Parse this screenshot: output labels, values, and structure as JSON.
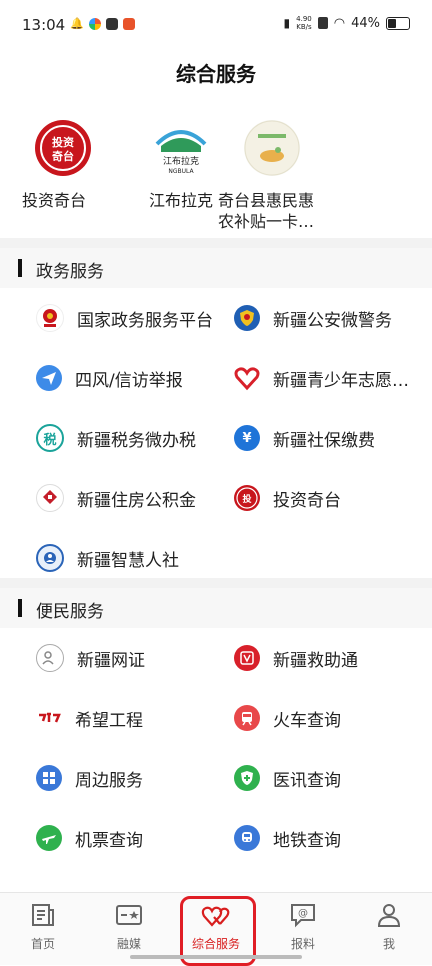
{
  "status_bar": {
    "time": "13:04",
    "net_speed_value": "4.90",
    "net_speed_unit": "KB/s",
    "battery": "44%"
  },
  "header": {
    "title": "综合服务"
  },
  "featured": [
    {
      "label": "投资奇台",
      "logo_text": "投资奇台"
    },
    {
      "label": "江布拉克",
      "logo_text": "江布拉克"
    },
    {
      "label": "奇台县惠民惠农补贴一卡…"
    }
  ],
  "sections": [
    {
      "title": "政务服务",
      "items": [
        {
          "label": "国家政务服务平台",
          "icon": "national-emblem-icon",
          "color": "#c8161d"
        },
        {
          "label": "新疆公安微警务",
          "icon": "police-badge-icon",
          "color": "#1f5fb4"
        },
        {
          "label": "四风/信访举报",
          "icon": "paper-plane-icon",
          "color": "#3d8be8"
        },
        {
          "label": "新疆青少年志愿…",
          "icon": "heart-icon",
          "color": "#d8202a"
        },
        {
          "label": "新疆税务微办税",
          "icon": "tax-icon",
          "color": "#1aa39a",
          "glyph": "税"
        },
        {
          "label": "新疆社保缴费",
          "icon": "yuan-icon",
          "color": "#1f74d8",
          "glyph": "¥"
        },
        {
          "label": "新疆住房公积金",
          "icon": "housing-fund-icon",
          "color": "#c41e2a"
        },
        {
          "label": "投资奇台",
          "icon": "invest-qitai-icon",
          "color": "#c8161d"
        },
        {
          "label": "新疆智慧人社",
          "icon": "smart-hr-icon",
          "color": "#2a64b8"
        }
      ]
    },
    {
      "title": "便民服务",
      "items": [
        {
          "label": "新疆网证",
          "icon": "web-id-icon",
          "color": "#888888"
        },
        {
          "label": "新疆救助通",
          "icon": "rescue-icon",
          "color": "#d8202a"
        },
        {
          "label": "希望工程",
          "icon": "hope-project-icon",
          "color": "#c8161d"
        },
        {
          "label": "火车查询",
          "icon": "train-icon",
          "color": "#e8484a"
        },
        {
          "label": "周边服务",
          "icon": "nearby-icon",
          "color": "#3a78d8"
        },
        {
          "label": "医讯查询",
          "icon": "medical-shield-icon",
          "color": "#2fb14e"
        },
        {
          "label": "机票查询",
          "icon": "plane-icon",
          "color": "#2fb14e"
        },
        {
          "label": "地铁查询",
          "icon": "metro-icon",
          "color": "#3a78d8"
        }
      ]
    }
  ],
  "tabbar": {
    "items": [
      {
        "label": "首页",
        "icon": "news-icon"
      },
      {
        "label": "融媒",
        "icon": "media-icon"
      },
      {
        "label": "综合服务",
        "icon": "double-heart-icon",
        "active": true
      },
      {
        "label": "报料",
        "icon": "report-icon"
      },
      {
        "label": "我",
        "icon": "person-icon"
      }
    ],
    "active_color": "#d81e1e"
  }
}
